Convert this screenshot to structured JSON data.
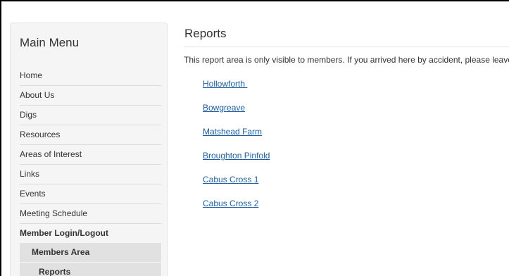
{
  "sidebar": {
    "title": "Main Menu",
    "items": [
      {
        "label": "Home"
      },
      {
        "label": "About Us"
      },
      {
        "label": "Digs"
      },
      {
        "label": "Resources"
      },
      {
        "label": "Areas of Interest"
      },
      {
        "label": "Links"
      },
      {
        "label": "Events"
      },
      {
        "label": "Meeting Schedule"
      },
      {
        "label": "Member Login/Logout"
      },
      {
        "label": "Members Area"
      },
      {
        "label": "Reports"
      }
    ]
  },
  "main": {
    "title": "Reports",
    "notice": "This report area is only visible to members.  If you arrived here by accident, please leave.",
    "links": [
      {
        "label": "Hollowforth "
      },
      {
        "label": "Bowgreave"
      },
      {
        "label": "Matshead Farm"
      },
      {
        "label": "Broughton Pinfold"
      },
      {
        "label": "Cabus Cross 1"
      },
      {
        "label": "Cabus Cross 2"
      }
    ]
  },
  "colors": {
    "link": "#1a5fa8",
    "submenu_background": "#e1e1e1",
    "sidebar_background": "#f5f5f5"
  }
}
